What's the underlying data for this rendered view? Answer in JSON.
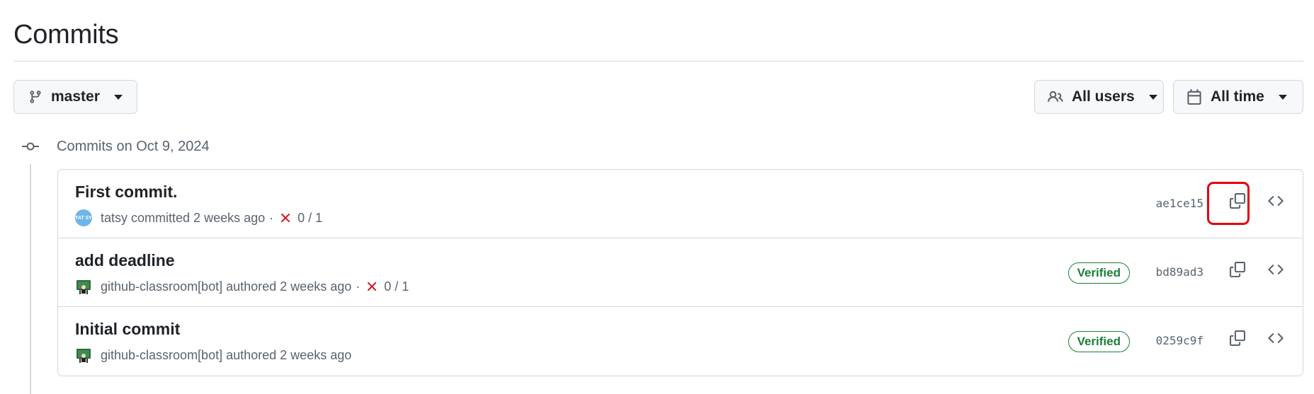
{
  "page": {
    "title": "Commits"
  },
  "filters": {
    "branch": {
      "label": "master",
      "icon": "git-branch-icon"
    },
    "users": {
      "label": "All users",
      "icon": "people-icon"
    },
    "time": {
      "label": "All time",
      "icon": "calendar-icon"
    }
  },
  "group": {
    "heading": "Commits on Oct 9, 2024"
  },
  "commits": [
    {
      "title": "First commit.",
      "avatar_text": "TAT SY",
      "author": "tatsy",
      "action": "committed 2 weeks ago",
      "separator": "·",
      "checks": "0 / 1",
      "verified": "",
      "sha": "ae1ce15"
    },
    {
      "title": "add deadline",
      "author": "github-classroom[bot]",
      "action": "authored 2 weeks ago",
      "separator": "·",
      "checks": "0 / 1",
      "verified": "Verified",
      "sha": "bd89ad3"
    },
    {
      "title": "Initial commit",
      "author": "github-classroom[bot]",
      "action": "authored 2 weeks ago",
      "verified": "Verified",
      "sha": "0259c9f"
    }
  ],
  "colors": {
    "verified": "#1a7f37",
    "fail": "#cf222e",
    "highlight": "#e4000f",
    "border": "#d0d7de"
  }
}
